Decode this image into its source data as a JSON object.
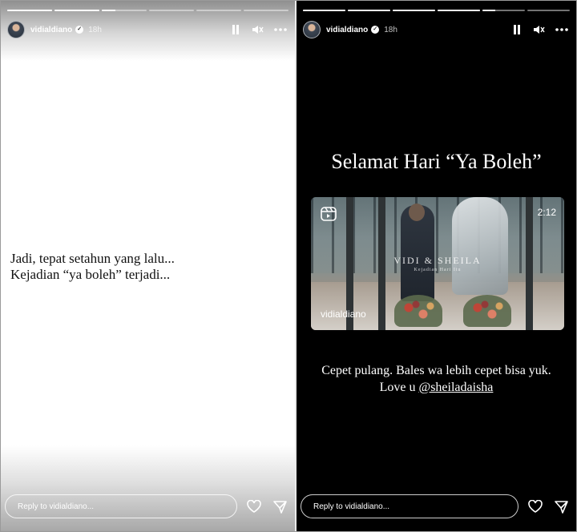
{
  "left_story": {
    "progress": [
      1,
      1,
      0.3,
      0,
      0,
      0
    ],
    "username": "vidialdiano",
    "time": "18h",
    "text": "Jadi, tepat setahun yang lalu...\nKejadian “ya boleh” terjadi...",
    "reply_placeholder": "Reply to vidialdiano..."
  },
  "right_story": {
    "progress": [
      1,
      1,
      1,
      1,
      0.3,
      0
    ],
    "username": "vidialdiano",
    "time": "18h",
    "title": "Selamat Hari “Ya Boleh”",
    "reel": {
      "duration": "2:12",
      "author": "vidialdiano",
      "overlay_title": "VIDI & SHEILA",
      "overlay_subtitle": "Kejadian Hari Itu"
    },
    "caption_line1": "Cepet pulang. Bales wa lebih cepet bisa yuk.",
    "caption_prefix": "Love u ",
    "caption_mention": "@sheiladaisha",
    "reply_placeholder": "Reply to vidialdiano..."
  },
  "colors": {
    "story_dark_bg": "#000000",
    "story_light_bg": "#ffffff",
    "text_on_dark": "#ffffff",
    "text_on_light": "#111111"
  },
  "icons": [
    "pause-icon",
    "mute-icon",
    "more-icon",
    "heart-icon",
    "send-icon",
    "verified-icon",
    "reels-icon"
  ]
}
